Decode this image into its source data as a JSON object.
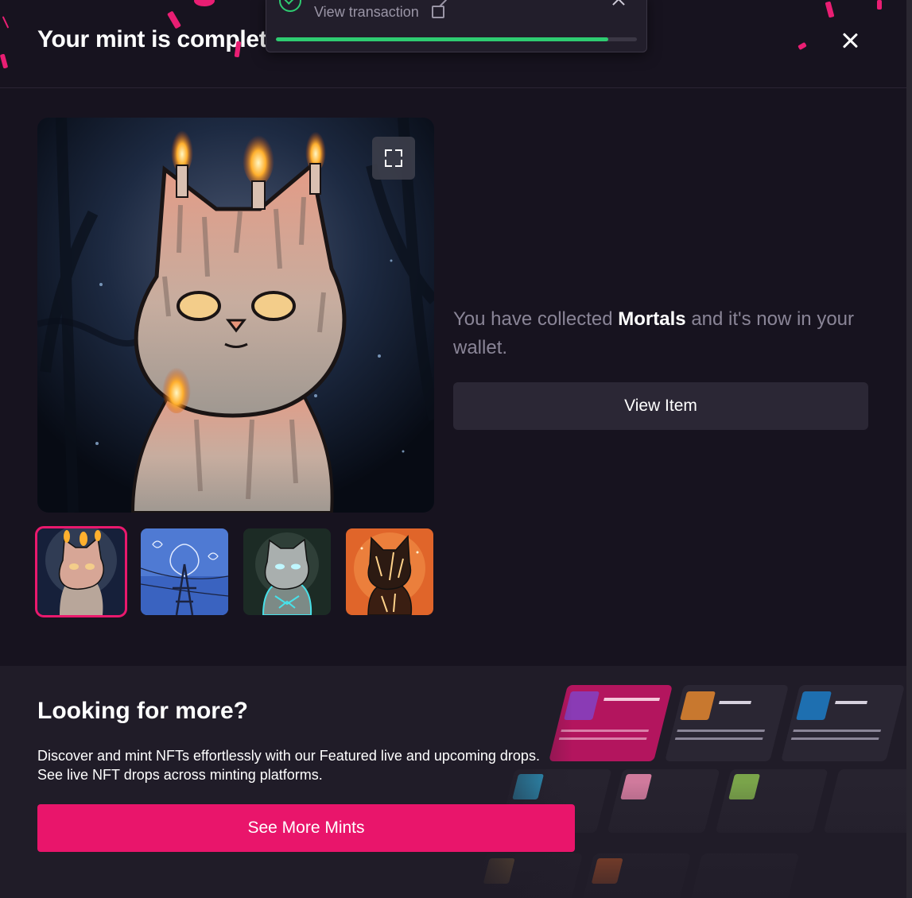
{
  "header": {
    "title": "Your mint is complete"
  },
  "toast": {
    "link_label": "View transaction",
    "progress": 0.92
  },
  "nft": {
    "collection": "Mortals",
    "message_prefix": "You have collected",
    "message_suffix": "and it's now in your wallet.",
    "view_item_label": "View Item"
  },
  "gallery": {
    "selected_index": 0,
    "thumbnail_count": 4
  },
  "more": {
    "title": "Looking for more?",
    "description_line1": "Discover and mint NFTs effortlessly with our Featured live and upcoming drops.",
    "description_line2": "See live NFT drops across minting platforms.",
    "button_label": "See More Mints"
  },
  "colors": {
    "accent": "#e9156b",
    "success": "#2ecc71",
    "background": "#17131f",
    "panel": "#201c28"
  },
  "icons": [
    "check-circle-icon",
    "external-link-icon",
    "close-icon",
    "expand-icon"
  ]
}
